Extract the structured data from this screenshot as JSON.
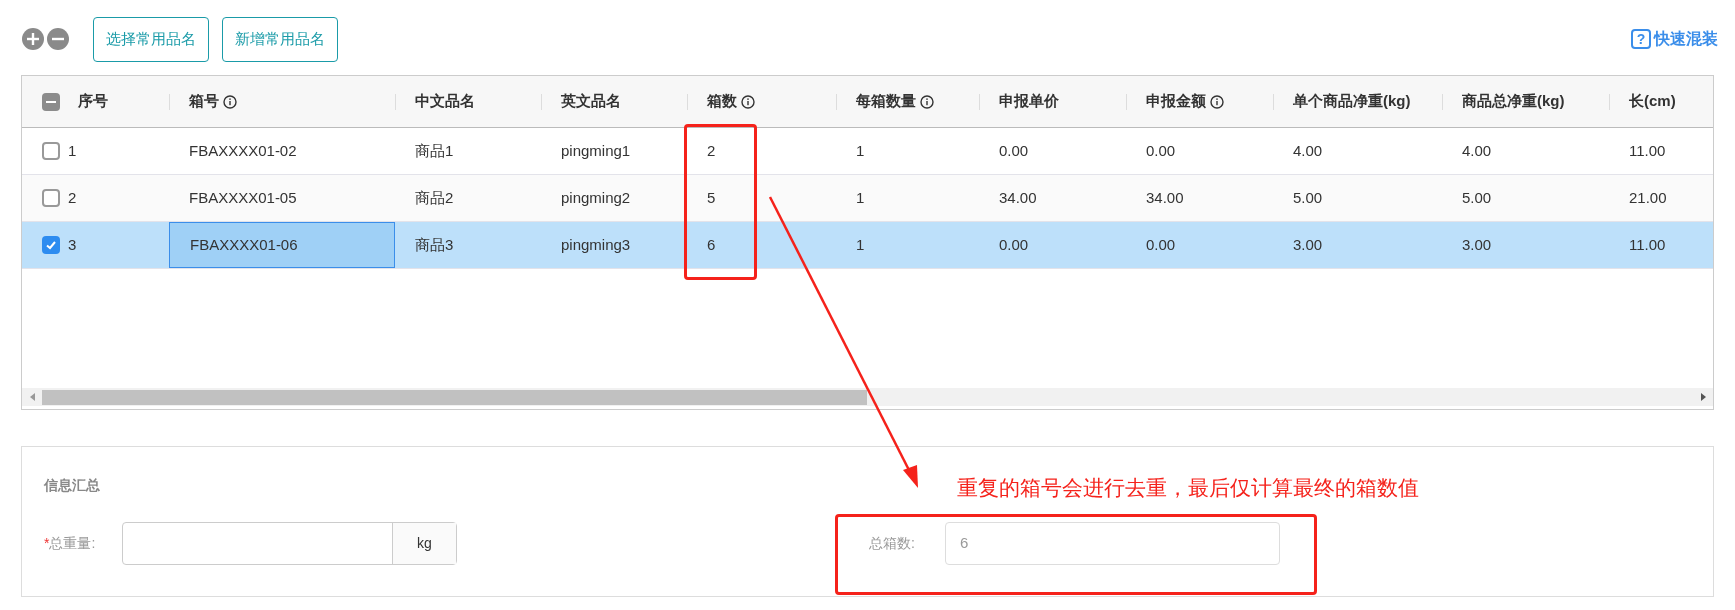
{
  "toolbar": {
    "buttons": [
      "选择常用品名",
      "新增常用品名"
    ],
    "help_icon": "?",
    "help_link": "快速混装"
  },
  "table": {
    "select_all": {
      "indeterminate": true
    },
    "columns": [
      {
        "label": "序号",
        "info": false
      },
      {
        "label": "箱号",
        "info": true
      },
      {
        "label": "中文品名",
        "info": false
      },
      {
        "label": "英文品名",
        "info": false
      },
      {
        "label": "箱数",
        "info": true
      },
      {
        "label": "每箱数量",
        "info": true
      },
      {
        "label": "申报单价",
        "info": false
      },
      {
        "label": "申报金额",
        "info": true
      },
      {
        "label": "单个商品净重(kg)",
        "info": false
      },
      {
        "label": "商品总净重(kg)",
        "info": false
      },
      {
        "label": "长(cm)",
        "info": false
      }
    ],
    "rows": [
      {
        "selected": false,
        "cells": [
          "1",
          "FBAXXXX01-02",
          "商品1",
          "pingming1",
          "2",
          "1",
          "0.00",
          "0.00",
          "4.00",
          "4.00",
          "11.00"
        ]
      },
      {
        "selected": false,
        "cells": [
          "2",
          "FBAXXXX01-05",
          "商品2",
          "pingming2",
          "5",
          "1",
          "34.00",
          "34.00",
          "5.00",
          "5.00",
          "21.00"
        ]
      },
      {
        "selected": true,
        "cells": [
          "3",
          "FBAXXXX01-06",
          "商品3",
          "pingming3",
          "6",
          "1",
          "0.00",
          "0.00",
          "3.00",
          "3.00",
          "11.00"
        ]
      }
    ]
  },
  "summary": {
    "title": "信息汇总",
    "total_weight": {
      "required_mark": "*",
      "label": "总重量:",
      "unit": "kg"
    },
    "total_boxes": {
      "label": "总箱数:",
      "value": "6"
    }
  },
  "annotation": {
    "note": "重复的箱号会进行去重，最后仅计算最终的箱数值"
  }
}
